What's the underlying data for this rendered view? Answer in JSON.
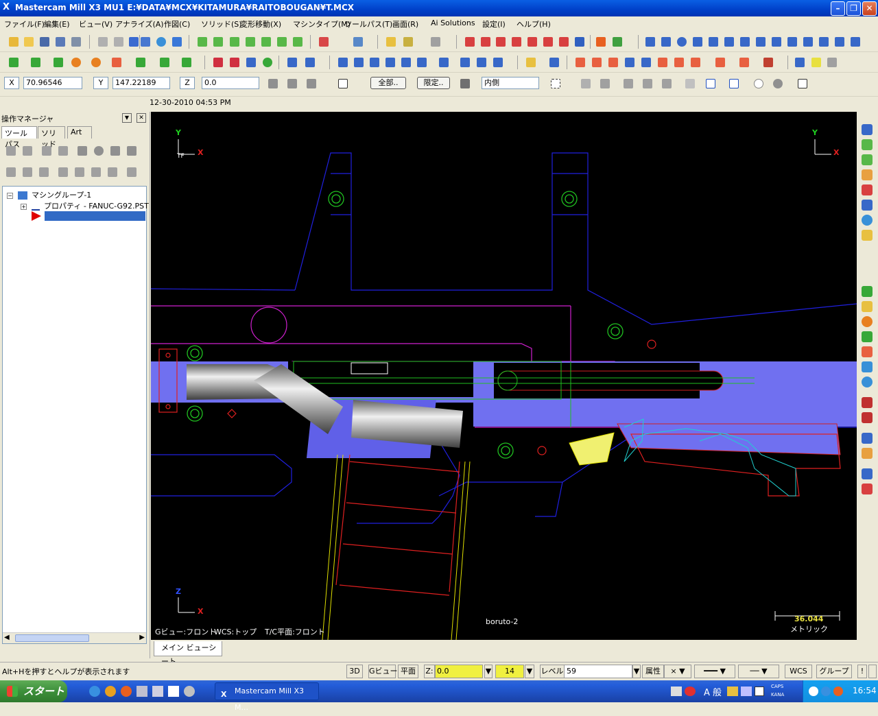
{
  "window": {
    "title": "Mastercam Mill X3 MU1   E:¥DATA¥MCX¥KITAMURA¥RAITOBOUGAN¥T.MCX"
  },
  "menu": [
    "ファイル(F)",
    "編集(E)",
    "ビュー(V)",
    "アナライズ(A)",
    "作図(C)",
    "ソリッド(S)",
    "変形移動(X)",
    "マシンタイプ(M)",
    "ツールパス(T)",
    "画面(R)",
    "Ai Solutions",
    "設定(I)",
    "ヘルプ(H)"
  ],
  "coords": {
    "x_label": "X",
    "x_value": "70.96546",
    "y_label": "Y",
    "y_value": "147.22189",
    "z_label": "Z",
    "z_value": "0.0",
    "all_button": "全部..",
    "limit_button": "限定..",
    "mode_value": "内側"
  },
  "datetime": "12-30-2010 04:53 PM",
  "op_manager": {
    "title": "操作マネージャ",
    "tabs": [
      "ツールパス",
      "ソリッド",
      "Art"
    ],
    "tree": {
      "group": "マシングループ-1",
      "properties": "プロパティ - FANUC-G92.PST"
    }
  },
  "viewport": {
    "axis_y": "Y",
    "axis_x": "X",
    "axis_z": "Z",
    "tf_label": "TF",
    "gview": "Gビュー:フロント",
    "wcs": "WCS:トップ",
    "tc_plane": "T/C平面:フロント",
    "level_name": "boruto-2",
    "scale_value": "36.044",
    "scale_unit": "メトリック"
  },
  "sheet_tab": "メイン ビューシート",
  "status": {
    "hint": "Alt+Hを押すとヘルプが表示されます",
    "btn_3d": "3D",
    "btn_gview": "Gビュー",
    "btn_plane": "平面",
    "z_label": "Z:",
    "z_value": "0.0",
    "color_value": "14",
    "level_label": "レベル",
    "level_value": "59",
    "attr": "属性",
    "wcs": "WCS",
    "group": "グループ"
  },
  "taskbar": {
    "start": "スタート",
    "task": "Mastercam Mill X3 M...",
    "ime": "A 般",
    "caps": "CAPS",
    "kana": "KANA",
    "clock": "16:54"
  }
}
